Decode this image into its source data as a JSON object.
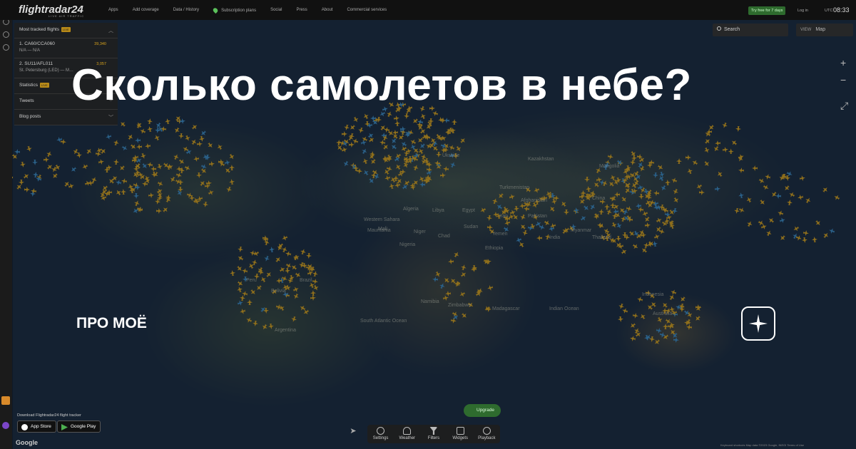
{
  "overlay": {
    "title": "Сколько самолетов в небе?",
    "brand_text": "ПРО МОЁ"
  },
  "header": {
    "logo": "flightradar24",
    "logo_sub": "LIVE AIR TRAFFIC",
    "nav": [
      "Apps",
      "Add coverage",
      "Data / History",
      "Subscription plans",
      "Social",
      "Press",
      "About",
      "Commercial services"
    ],
    "try_label": "Try free for 7 days",
    "login_label": "Log in",
    "utc_label": "UTC",
    "clock": "08:33"
  },
  "panel": {
    "most_tracked_label": "Most tracked flights",
    "live_badge": "LIVE",
    "flights": [
      {
        "title": "1. CA60/CCA060",
        "route": "N/A — N/A",
        "count": "39,340"
      },
      {
        "title": "2. SU11/AFL011",
        "route": "St. Petersburg (LED) — M…",
        "count": "3,057"
      }
    ],
    "statistics_label": "Statistics",
    "tweets_label": "Tweets",
    "blog_label": "Blog posts"
  },
  "map_controls": {
    "search_placeholder": "Search",
    "view_label": "VIEW",
    "view_value": "Map"
  },
  "regions": [
    "Ukraine",
    "Kazakhstan",
    "Algeria",
    "Libya",
    "Egypt",
    "Mali",
    "Niger",
    "Chad",
    "Sudan",
    "Nigeria",
    "Ethiopia",
    "Yemen",
    "Turkmenistan",
    "Afghanistan",
    "Iran",
    "Pakistan",
    "Mongolia",
    "China",
    "India",
    "Myanmar",
    "Thailand",
    "Indonesia",
    "Australia",
    "Namibia",
    "Zimbabwe",
    "Madagascar",
    "South Atlantic Ocean",
    "Indian Ocean",
    "Peru",
    "Bolivia",
    "Brazil",
    "Argentina",
    "Western Sahara",
    "Mauritania"
  ],
  "bottom": {
    "download_text": "Download Flightradar24 flight tracker",
    "app_store": "App Store",
    "google_play": "Google Play",
    "upgrade_label": "Upgrade",
    "tools": [
      "Settings",
      "Weather",
      "Filters",
      "Widgets",
      "Playback"
    ],
    "google_logo": "Google",
    "attribution": "Keyboard shortcuts  Map data ©2023 Google, INEGI  Terms of Use"
  }
}
